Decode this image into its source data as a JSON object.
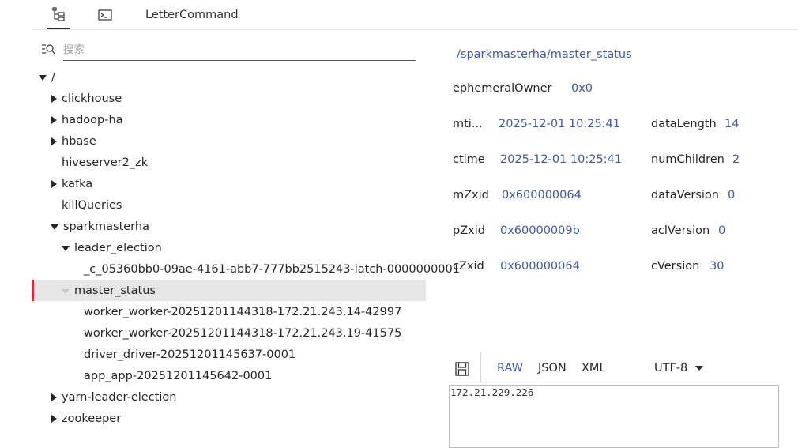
{
  "tabs": [
    {
      "name": "tree",
      "icon": "tree-icon"
    },
    {
      "name": "terminal",
      "icon": "terminal-icon"
    },
    {
      "label": "LetterCommand"
    }
  ],
  "search": {
    "placeholder": "搜索",
    "value": ""
  },
  "tree": {
    "root": "/",
    "nodes": [
      {
        "label": "clickhouse",
        "expanded": false
      },
      {
        "label": "hadoop-ha",
        "expanded": false
      },
      {
        "label": "hbase",
        "expanded": false
      },
      {
        "label": "hiveserver2_zk"
      },
      {
        "label": "kafka",
        "expanded": false
      },
      {
        "label": "killQueries"
      },
      {
        "label": "sparkmasterha",
        "expanded": true
      },
      {
        "label": "leader_election",
        "expanded": true
      },
      {
        "label": "_c_05360bb0-09ae-4161-abb7-777bb2515243-latch-0000000001"
      },
      {
        "label": "master_status",
        "expanded": true,
        "selected": true
      },
      {
        "label": "worker_worker-20251201144318-172.21.243.14-42997"
      },
      {
        "label": "worker_worker-20251201144318-172.21.243.19-41575"
      },
      {
        "label": "driver_driver-20251201145637-0001"
      },
      {
        "label": "app_app-20251201145642-0001"
      },
      {
        "label": "yarn-leader-election",
        "expanded": false
      },
      {
        "label": "zookeeper",
        "expanded": false
      }
    ]
  },
  "details": {
    "path": "/sparkmasterha/master_status",
    "ephemeralOwner": {
      "label": "ephemeralOwner",
      "value": "0x0"
    },
    "mtime": {
      "label": "mti...",
      "value": "2025-12-01 10:25:41"
    },
    "ctime": {
      "label": "ctime",
      "value": "2025-12-01 10:25:41"
    },
    "mZxid": {
      "label": "mZxid",
      "value": "0x600000064"
    },
    "pZxid": {
      "label": "pZxid",
      "value": "0x60000009b"
    },
    "cZxid": {
      "label": "cZxid",
      "value": "0x600000064"
    },
    "dataLength": {
      "label": "dataLength",
      "value": "14"
    },
    "numChildren": {
      "label": "numChildren",
      "value": "2"
    },
    "dataVersion": {
      "label": "dataVersion",
      "value": "0"
    },
    "aclVersion": {
      "label": "aclVersion",
      "value": "0"
    },
    "cVersion": {
      "label": "cVersion",
      "value": "30"
    }
  },
  "data_panel": {
    "formats": [
      "RAW",
      "JSON",
      "XML"
    ],
    "active_format": "RAW",
    "encoding": "UTF-8",
    "content": "172.21.229.226"
  },
  "colors": {
    "accent": "#3b5ba8",
    "selected_bar": "#e0282e",
    "selected_bg": "#e6e6e6"
  }
}
